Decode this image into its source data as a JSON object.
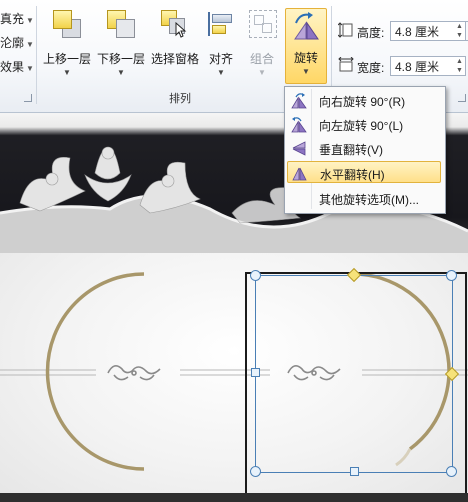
{
  "ribbon": {
    "left_stub": [
      {
        "label": "填充",
        "visible": "真充"
      },
      {
        "label": "轮廓",
        "visible": "沦廓"
      },
      {
        "label": "效果",
        "visible": "效果"
      }
    ],
    "buttons": {
      "bring_forward": "上移一层",
      "send_backward": "下移一层",
      "selection_pane": "选择窗格",
      "align": "对齐",
      "group": "组合",
      "rotate": "旋转"
    },
    "group_label": "排列",
    "height_label": "高度:",
    "height_value": "4.8 厘米",
    "width_label": "宽度:",
    "width_value": "4.8 厘米"
  },
  "rotate_menu": {
    "items": [
      {
        "label": "向右旋转 90°(R)",
        "icon": "rotate-right-icon"
      },
      {
        "label": "向左旋转 90°(L)",
        "icon": "rotate-left-icon"
      },
      {
        "label": "垂直翻转(V)",
        "icon": "flip-vertical-icon"
      },
      {
        "label": "水平翻转(H)",
        "icon": "flip-horizontal-icon",
        "highlighted": true
      },
      {
        "label": "其他旋转选项(M)...",
        "icon": ""
      }
    ]
  },
  "colors": {
    "accent_gold": "#a8976a",
    "selection_blue": "#4a7fb5",
    "handle_fill": "#e8f2fb",
    "handle_yellow": "#f6e27a"
  }
}
